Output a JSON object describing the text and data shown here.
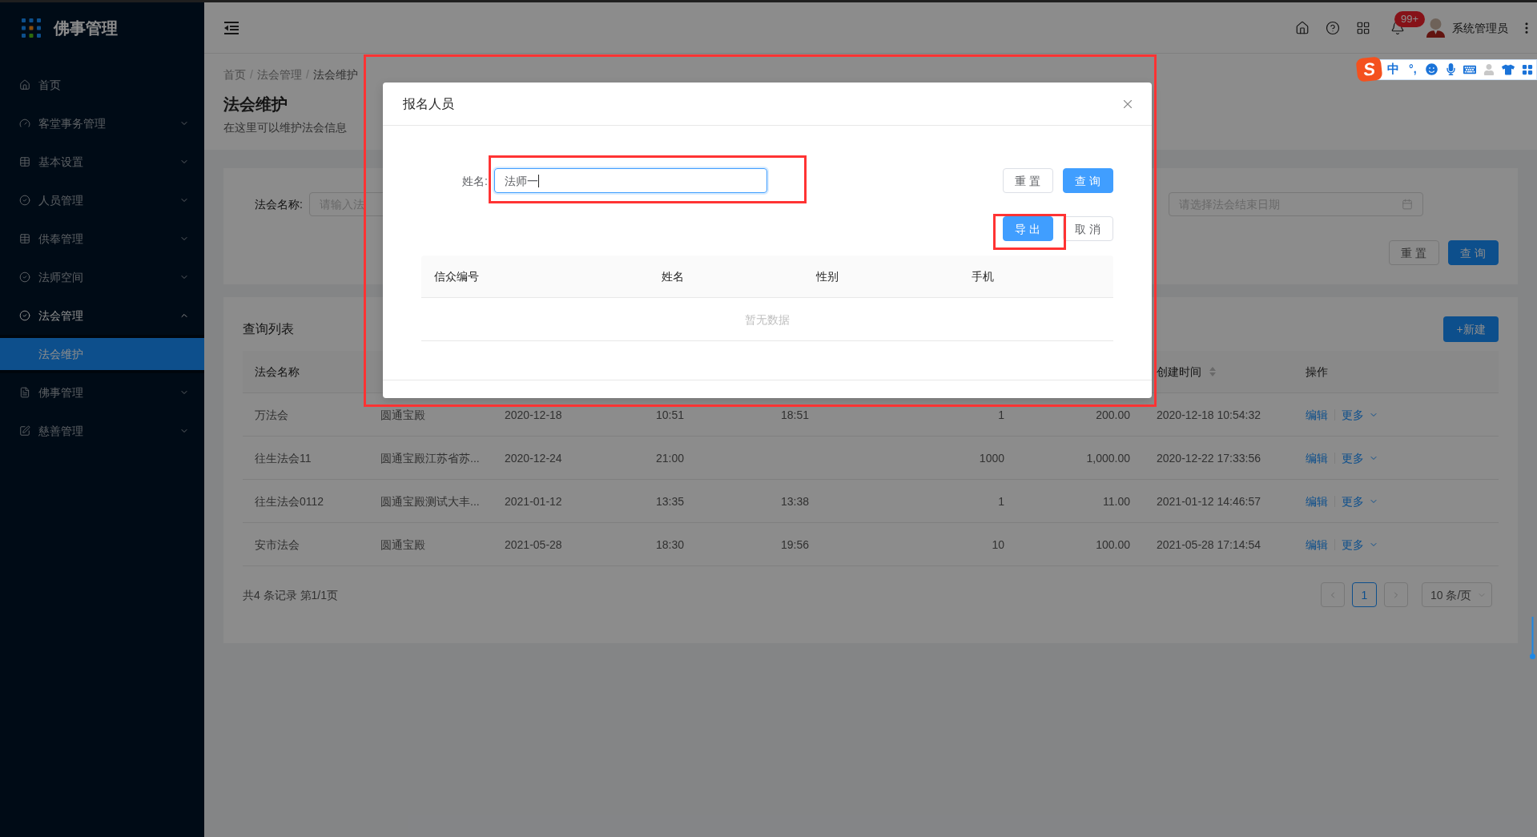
{
  "header": {
    "notification_count": "99+",
    "user_name": "系统管理员"
  },
  "ime_toolbar": {
    "logo": "S",
    "mode": "中",
    "punctuation": "°,"
  },
  "sidebar": {
    "title": "佛事管理",
    "items": [
      {
        "label": "首页",
        "kind": "link",
        "selected": false
      },
      {
        "label": "客堂事务管理",
        "kind": "submenu",
        "selected": false,
        "expanded": false
      },
      {
        "label": "基本设置",
        "kind": "submenu",
        "selected": false,
        "expanded": false
      },
      {
        "label": "人员管理",
        "kind": "submenu",
        "selected": false,
        "expanded": false
      },
      {
        "label": "供奉管理",
        "kind": "submenu",
        "selected": false,
        "expanded": false
      },
      {
        "label": "法师空间",
        "kind": "submenu",
        "selected": false,
        "expanded": false
      },
      {
        "label": "法会管理",
        "kind": "submenu",
        "selected": true,
        "expanded": true,
        "children": [
          {
            "label": "法会维护",
            "selected": true
          }
        ]
      },
      {
        "label": "佛事管理",
        "kind": "submenu",
        "selected": false,
        "expanded": false
      },
      {
        "label": "慈善管理",
        "kind": "submenu",
        "selected": false,
        "expanded": false
      }
    ]
  },
  "breadcrumb": {
    "items": [
      {
        "label": "首页",
        "separator": "/"
      },
      {
        "label": "法会管理",
        "separator": "/"
      },
      {
        "label": "法会维护"
      }
    ]
  },
  "page_header": {
    "title": "法会维护",
    "description": "在这里可以维护法会信息"
  },
  "search_form": {
    "fields": [
      {
        "kind": "text",
        "label": "法会名称:",
        "placeholder": "请输入法"
      },
      {
        "kind": "date",
        "placeholder": "请选择法会结束日期"
      }
    ],
    "buttons": [
      {
        "label": "重置",
        "kind": "default"
      },
      {
        "label": "查询",
        "kind": "primary"
      }
    ]
  },
  "list": {
    "title": "查询列表",
    "new_button": "+新建",
    "columns": [
      {
        "label": "法会名称",
        "sortable": false
      },
      {
        "label": "创建时间",
        "sortable": true
      },
      {
        "label": "操作",
        "sortable": false
      }
    ],
    "rows": [
      {
        "name": "万法会",
        "column_2": "圆通宝殿",
        "column_3": "2020-12-18",
        "column_4": "10:51",
        "column_5": "18:51",
        "column_6": "1",
        "column_7": "200.00",
        "created_at": "2020-12-18 10:54:32",
        "actions": [
          {
            "label": "编辑",
            "kind": "link"
          },
          {
            "label": "更多",
            "kind": "dropdown"
          }
        ]
      },
      {
        "name": "往生法会11",
        "column_2": "圆通宝殿江苏省苏...",
        "column_3": "2020-12-24",
        "column_4": "21:00",
        "column_6": "1000",
        "column_7": "1,000.00",
        "created_at": "2020-12-22 17:33:56",
        "actions": [
          {
            "label": "编辑",
            "kind": "link"
          },
          {
            "label": "更多",
            "kind": "dropdown"
          }
        ]
      },
      {
        "name": "往生法会0112",
        "column_2": "圆通宝殿测试大丰...",
        "column_3": "2021-01-12",
        "column_4": "13:35",
        "column_5": "13:38",
        "column_6": "1",
        "column_7": "11.00",
        "created_at": "2021-01-12 14:46:57",
        "actions": [
          {
            "label": "编辑",
            "kind": "link"
          },
          {
            "label": "更多",
            "kind": "dropdown"
          }
        ]
      },
      {
        "name": "安市法会",
        "column_2": "圆通宝殿",
        "column_3": "2021-05-28",
        "column_4": "18:30",
        "column_5": "19:56",
        "column_6": "10",
        "column_7": "100.00",
        "created_at": "2021-05-28 17:14:54",
        "actions": [
          {
            "label": "编辑",
            "kind": "link"
          },
          {
            "label": "更多",
            "kind": "dropdown"
          }
        ]
      }
    ],
    "summary": "共4 条记录 第1/1页",
    "pagination": {
      "pages": [
        {
          "label": "1",
          "selected": true
        }
      ],
      "page_size": "10 条/页"
    }
  },
  "modal": {
    "title": "报名人员",
    "form": {
      "label": "姓名:",
      "value": "法师一",
      "focused": true
    },
    "buttons": [
      {
        "label": "重置",
        "kind": "default"
      },
      {
        "label": "查询",
        "kind": "primary"
      },
      {
        "label": "导出",
        "kind": "primary"
      },
      {
        "label": "取消",
        "kind": "default"
      }
    ],
    "table": {
      "columns": [
        "信众编号",
        "姓名",
        "性别",
        "手机"
      ],
      "empty_text": "暂无数据"
    }
  }
}
